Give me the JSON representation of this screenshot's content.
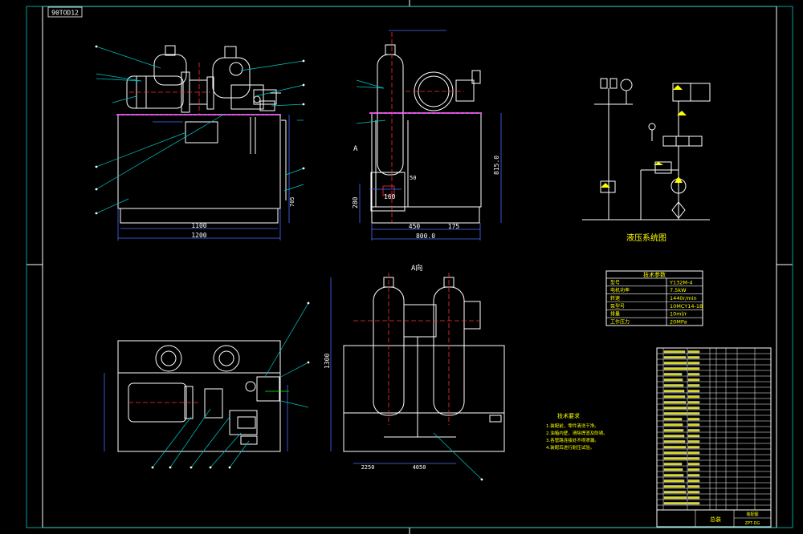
{
  "colors": {
    "background": "#000000",
    "frame": "#ffffff",
    "dimension": "#4a6bff",
    "leader": "#00c8c8",
    "parts": "#ffffff",
    "centerline": "#ff3030",
    "surface": "#ff40ff",
    "green": "#00ff00",
    "yellow": "#ffff00"
  },
  "stamp": "90TOD12",
  "front_view": {
    "dims": {
      "overall_a": "1100",
      "overall_b": "1200",
      "height": "705"
    }
  },
  "side_view": {
    "label": "A",
    "dims": {
      "depth_a": "450",
      "depth_b": "175",
      "total": "800.0",
      "height": "815.0",
      "base_h": "280",
      "small": "160",
      "s50": "50"
    }
  },
  "aux_view": {
    "label": "A向",
    "dims": {
      "height": "1300",
      "w_left": "2250",
      "w_right": "4050"
    }
  },
  "hydraulic": {
    "title": "液压系统图"
  },
  "tech_params": {
    "header": "技术参数",
    "rows": [
      {
        "label": "型号",
        "value": "Y132M-4"
      },
      {
        "label": "电机功率",
        "value": "7.5kW"
      },
      {
        "label": "转速",
        "value": "1440r/min"
      },
      {
        "label": "泵型号",
        "value": "10MCY14-1B"
      },
      {
        "label": "排量",
        "value": "10ml/r"
      },
      {
        "label": "工作压力",
        "value": "20MPa"
      }
    ]
  },
  "tech_requirements": {
    "title": "技术要求",
    "lines": [
      "1.装配前，零件清洗干净。",
      "2.油箱内壁，清除焊渣及防锈。",
      "3.各管路连接处不得渗漏。",
      "4.装配后进行耐压试验。"
    ]
  },
  "title_block": {
    "drawing_title": "总装",
    "sheet": "装配图",
    "code": "ZPT-DG"
  }
}
